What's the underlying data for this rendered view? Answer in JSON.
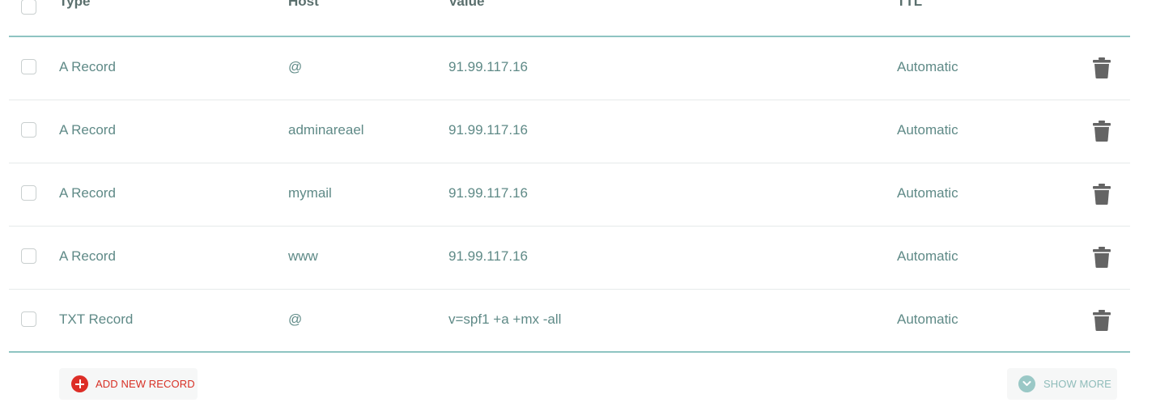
{
  "table": {
    "columns": {
      "type": "Type",
      "host": "Host",
      "value": "Value",
      "ttl": "TTL"
    },
    "rows": [
      {
        "type": "A Record",
        "host": "@",
        "value": "91.99.117.16",
        "ttl": "Automatic"
      },
      {
        "type": "A Record",
        "host": "adminareael",
        "value": "91.99.117.16",
        "ttl": "Automatic"
      },
      {
        "type": "A Record",
        "host": "mymail",
        "value": "91.99.117.16",
        "ttl": "Automatic"
      },
      {
        "type": "A Record",
        "host": "www",
        "value": "91.99.117.16",
        "ttl": "Automatic"
      },
      {
        "type": "TXT Record",
        "host": "@",
        "value": "v=spf1 +a +mx -all",
        "ttl": "Automatic"
      }
    ]
  },
  "footer": {
    "add_label": "ADD NEW RECORD",
    "more_label": "SHOW MORE"
  },
  "icons": {
    "delete": "trash-icon",
    "add": "plus-circle-icon",
    "more": "chevron-down-circle-icon"
  },
  "colors": {
    "accent": "#8ec4c2",
    "add": "#dd2e27",
    "text": "#5f8a87"
  }
}
